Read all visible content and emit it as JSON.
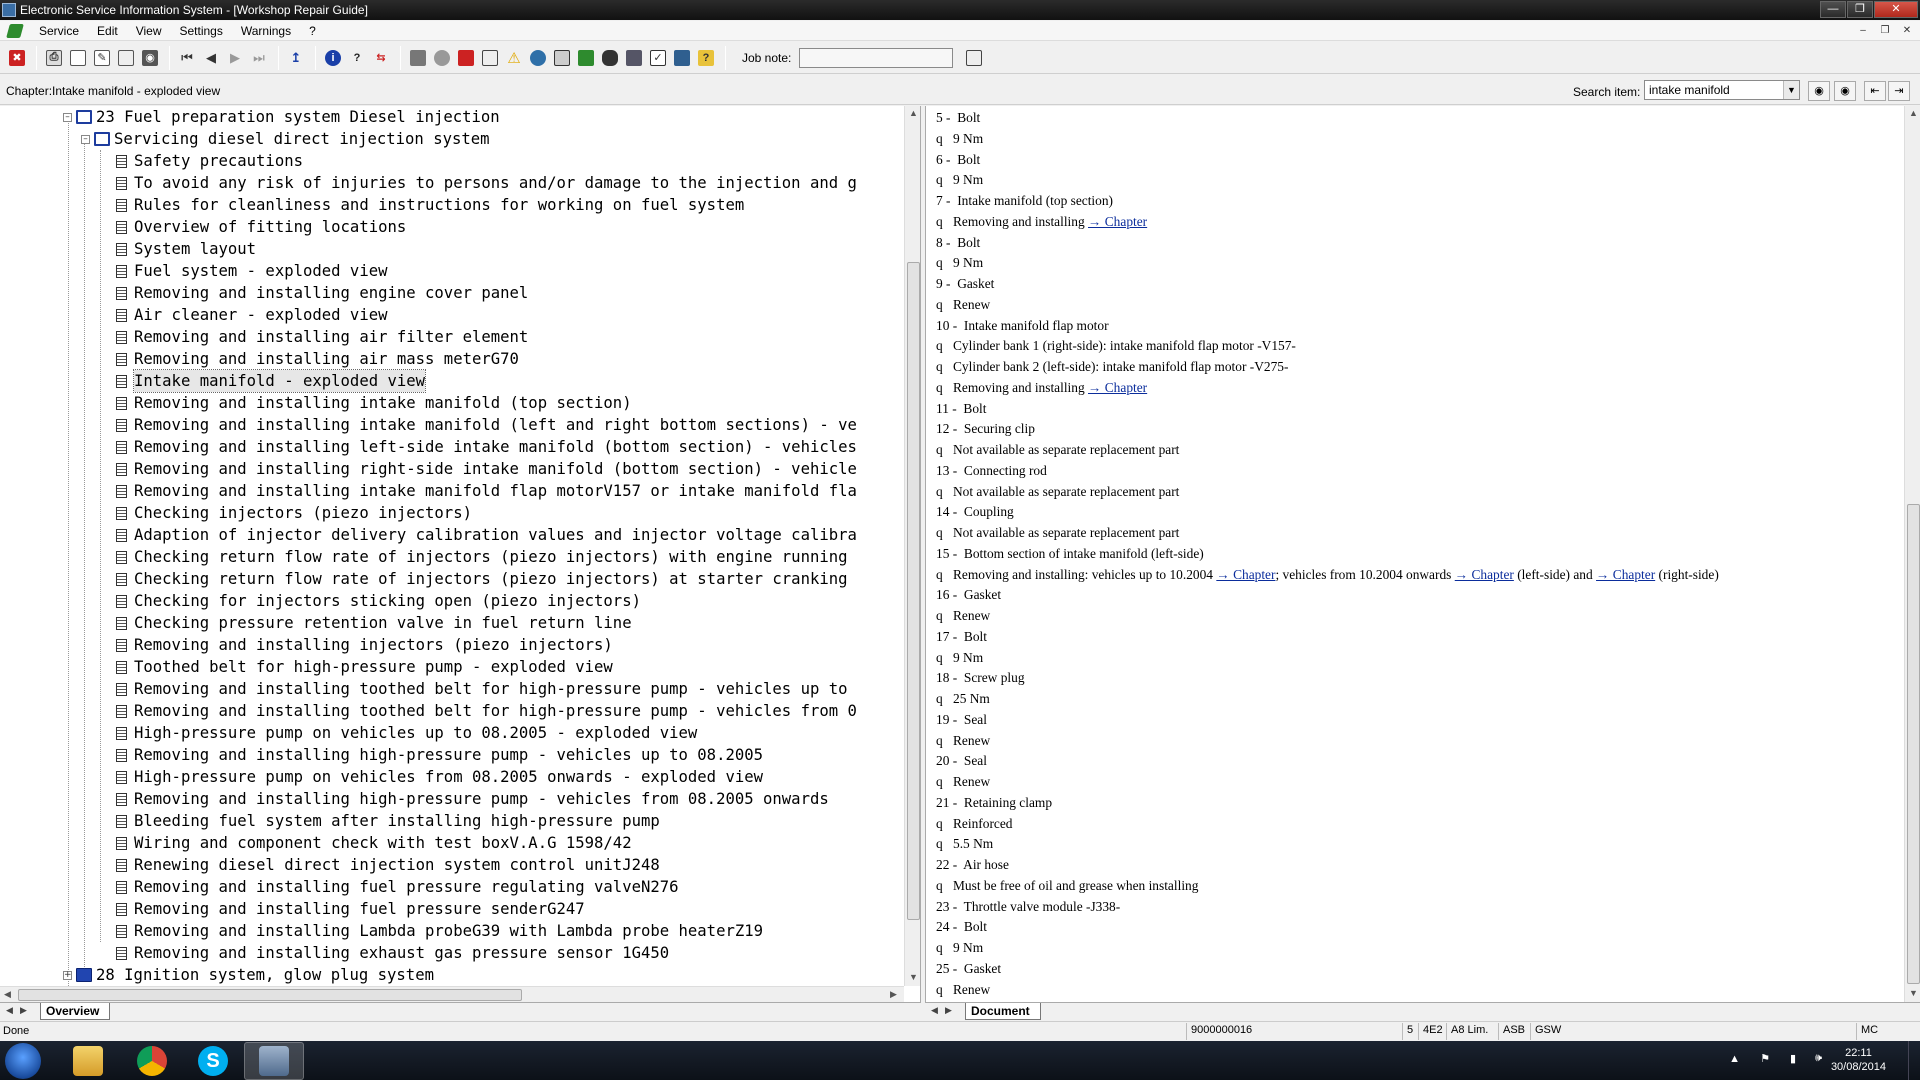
{
  "window": {
    "title": "Electronic Service Information System - [Workshop Repair Guide]"
  },
  "menu": [
    "Service",
    "Edit",
    "View",
    "Settings",
    "Warnings",
    "?"
  ],
  "toolbar": {
    "job_note_label": "Job note:",
    "job_note_value": ""
  },
  "chapter_bar": {
    "chapter": "Chapter:Intake manifold - exploded view",
    "search_label": "Search item:",
    "search_value": "intake manifold"
  },
  "tree": {
    "top_node": "23 Fuel preparation system Diesel injection",
    "sub_node": "Servicing diesel direct injection system",
    "items": [
      "Safety precautions",
      "To avoid any risk of injuries to persons and/or damage to the injection and g",
      "Rules for cleanliness and instructions for working on fuel system",
      "Overview of fitting locations",
      "System layout",
      "Fuel system - exploded view",
      "Removing and installing engine cover panel",
      "Air cleaner - exploded view",
      "Removing and installing air filter element",
      "Removing and installing air mass meterG70",
      "Intake manifold - exploded view",
      "Removing and installing intake manifold (top section)",
      "Removing and installing intake manifold (left and right bottom sections) - ve",
      "Removing and installing left-side intake manifold (bottom section) - vehicles",
      "Removing and installing right-side intake manifold (bottom section) - vehicle",
      "Removing and installing intake manifold flap motorV157 or intake manifold fla",
      "Checking injectors (piezo injectors)",
      "Adaption of injector delivery calibration values and injector voltage calibra",
      "Checking return flow rate of injectors (piezo injectors) with engine running",
      "Checking return flow rate of injectors (piezo injectors) at starter cranking",
      "Checking for injectors sticking open (piezo injectors)",
      "Checking pressure retention valve in fuel return line",
      "Removing and installing injectors (piezo injectors)",
      "Toothed belt for high-pressure pump - exploded view",
      "Removing and installing toothed belt for high-pressure pump - vehicles up to",
      "Removing and installing toothed belt for high-pressure pump - vehicles from 0",
      "High-pressure pump on vehicles up to 08.2005 - exploded view",
      "Removing and installing high-pressure pump - vehicles up to 08.2005",
      "High-pressure pump on vehicles from 08.2005 onwards - exploded view",
      "Removing and installing high-pressure pump - vehicles from 08.2005 onwards",
      "Bleeding fuel system after installing high-pressure pump",
      "Wiring and component check with test boxV.A.G 1598/42",
      "Renewing diesel direct injection system control unitJ248",
      "Removing and installing fuel pressure regulating valveN276",
      "Removing and installing fuel pressure senderG247",
      "Removing and installing Lambda probeG39 with Lambda probe heaterZ19",
      "Removing and installing exhaust gas pressure sensor 1G450"
    ],
    "selected_index": 10,
    "bottom_node": "28 Ignition system, glow plug system"
  },
  "tabs": {
    "left": "Overview",
    "right": "Document"
  },
  "document": {
    "rows": [
      {
        "t": "5 -  Bolt"
      },
      {
        "q": "q",
        "t": "9 Nm"
      },
      {
        "t": "6 -  Bolt"
      },
      {
        "q": "q",
        "t": "9 Nm"
      },
      {
        "t": "7 -  Intake manifold (top section)"
      },
      {
        "q": "q",
        "t": "Removing and installing ",
        "link": "→ Chapter"
      },
      {
        "t": "8 -  Bolt"
      },
      {
        "q": "q",
        "t": "9 Nm"
      },
      {
        "t": "9 -  Gasket"
      },
      {
        "q": "q",
        "t": "Renew"
      },
      {
        "t": "10 -  Intake manifold flap motor"
      },
      {
        "q": "q",
        "t": "Cylinder bank 1 (right-side): intake manifold flap motor -V157-"
      },
      {
        "q": "q",
        "t": "Cylinder bank 2 (left-side): intake manifold flap motor -V275-"
      },
      {
        "q": "q",
        "t": "Removing and installing ",
        "link": "→ Chapter"
      },
      {
        "t": "11 -  Bolt"
      },
      {
        "t": "12 -  Securing clip"
      },
      {
        "q": "q",
        "t": "Not available as separate replacement part"
      },
      {
        "t": "13 -  Connecting rod"
      },
      {
        "q": "q",
        "t": "Not available as separate replacement part"
      },
      {
        "t": "14 -  Coupling"
      },
      {
        "q": "q",
        "t": "Not available as separate replacement part"
      },
      {
        "t": "15 -  Bottom section of intake manifold (left-side)"
      },
      {
        "q": "q",
        "t": "Removing and installing: vehicles up to 10.2004 ",
        "link": "→ Chapter",
        "t2": "; vehicles from 10.2004 onwards ",
        "link2": "→ Chapter",
        "t3": " (left-side) and ",
        "link3": "→ Chapter",
        "t4": " (right-side)"
      },
      {
        "t": "16 -  Gasket"
      },
      {
        "q": "q",
        "t": "Renew"
      },
      {
        "t": "17 -  Bolt"
      },
      {
        "q": "q",
        "t": "9 Nm"
      },
      {
        "t": "18 -  Screw plug"
      },
      {
        "q": "q",
        "t": "25 Nm"
      },
      {
        "t": "19 -  Seal"
      },
      {
        "q": "q",
        "t": "Renew"
      },
      {
        "t": "20 -  Seal"
      },
      {
        "q": "q",
        "t": "Renew"
      },
      {
        "t": "21 -  Retaining clamp"
      },
      {
        "q": "q",
        "t": "Reinforced"
      },
      {
        "q": "q",
        "t": "5.5 Nm"
      },
      {
        "t": "22 -  Air hose"
      },
      {
        "q": "q",
        "t": "Must be free of oil and grease when installing"
      },
      {
        "t": "23 -  Throttle valve module -J338-"
      },
      {
        "t": "24 -  Bolt"
      },
      {
        "q": "q",
        "t": "9 Nm"
      },
      {
        "t": "25 -  Gasket"
      },
      {
        "q": "q",
        "t": "Renew"
      }
    ]
  },
  "status": {
    "text": "Done",
    "cells": [
      "9000000016",
      "5",
      "4E2",
      "A8 Lim.",
      "ASB",
      "GSW",
      "MC"
    ]
  },
  "taskbar": {
    "time": "22:11",
    "date": "30/08/2014"
  },
  "colors": {
    "link": "#0b2d9c",
    "book": "#2145b0"
  }
}
